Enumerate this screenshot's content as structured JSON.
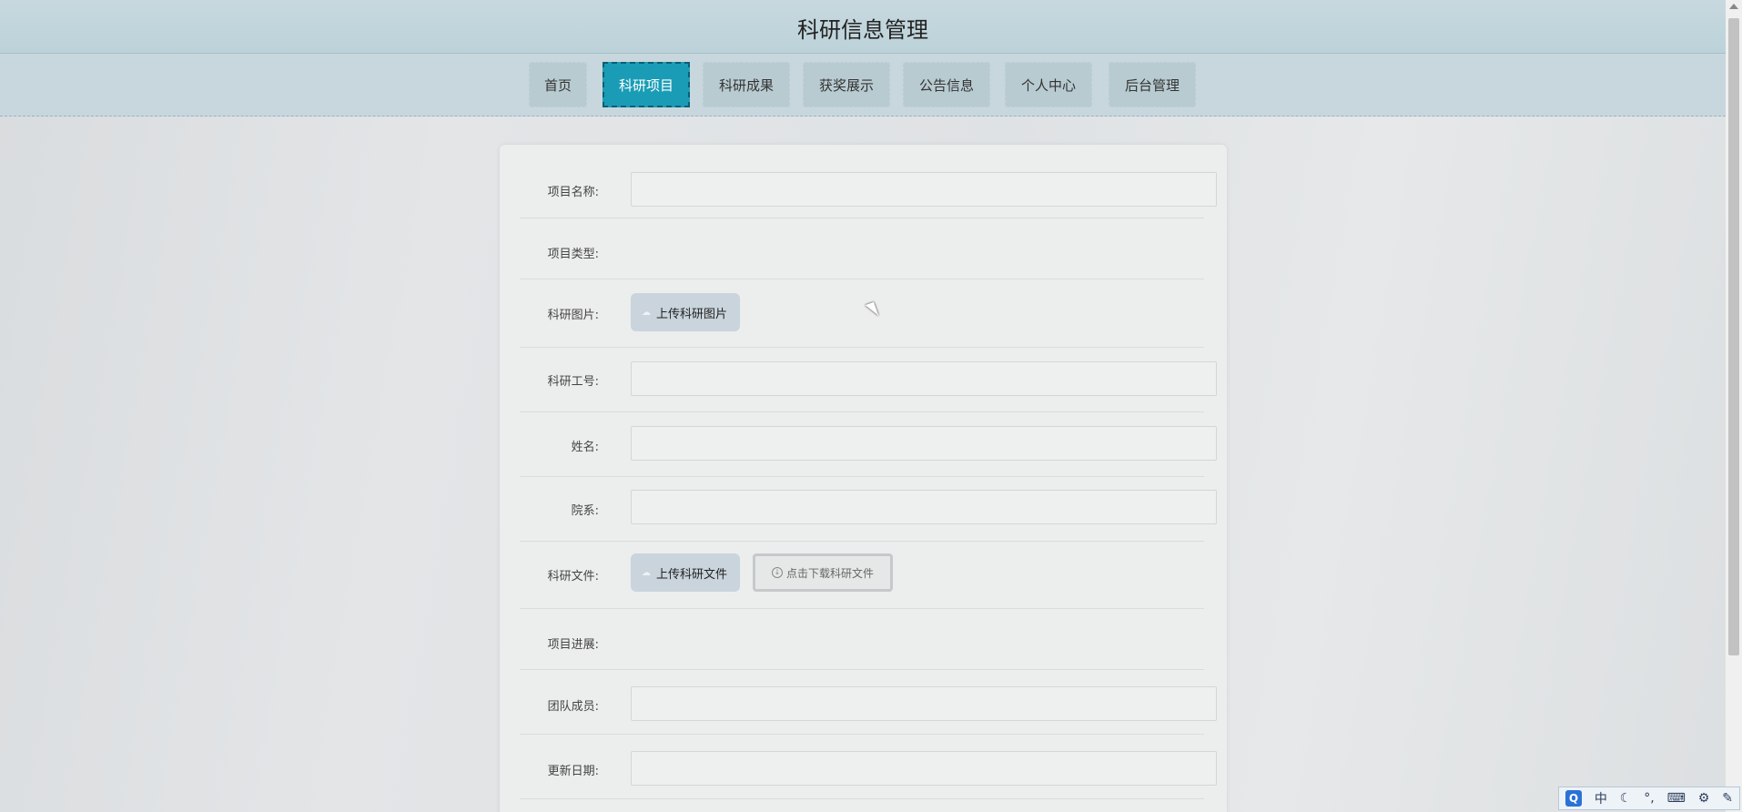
{
  "header": {
    "title": "科研信息管理"
  },
  "nav": {
    "items": [
      {
        "label": "首页"
      },
      {
        "label": "科研项目"
      },
      {
        "label": "科研成果"
      },
      {
        "label": "获奖展示"
      },
      {
        "label": "公告信息"
      },
      {
        "label": "个人中心"
      },
      {
        "label": "后台管理"
      }
    ],
    "active": "科研项目"
  },
  "form": {
    "project_name": {
      "label": "项目名称:",
      "value": ""
    },
    "project_type": {
      "label": "项目类型:",
      "value": ""
    },
    "research_image": {
      "label": "科研图片:",
      "upload_label": "上传科研图片"
    },
    "staff_id": {
      "label": "科研工号:",
      "value": ""
    },
    "name": {
      "label": "姓名:",
      "value": ""
    },
    "department": {
      "label": "院系:",
      "value": ""
    },
    "research_file": {
      "label": "科研文件:",
      "upload_label": "上传科研文件",
      "download_label": "点击下载科研文件"
    },
    "progress": {
      "label": "项目进展:",
      "value": ""
    },
    "team_members": {
      "label": "团队成员:",
      "value": ""
    },
    "update_date": {
      "label": "更新日期:",
      "value": ""
    }
  },
  "ime": {
    "logo": "Q",
    "mode": "中",
    "items": [
      "moon-icon",
      "punctuation-icon",
      "keyboard-icon",
      "settings-icon",
      "tool-icon"
    ]
  },
  "colors": {
    "header_bg": "#bcd2d9",
    "nav_bg": "#c8d7dd",
    "nav_item_bg": "#b8cbd1",
    "nav_active_bg": "#1a9cb6",
    "card_bg": "#eceded"
  }
}
